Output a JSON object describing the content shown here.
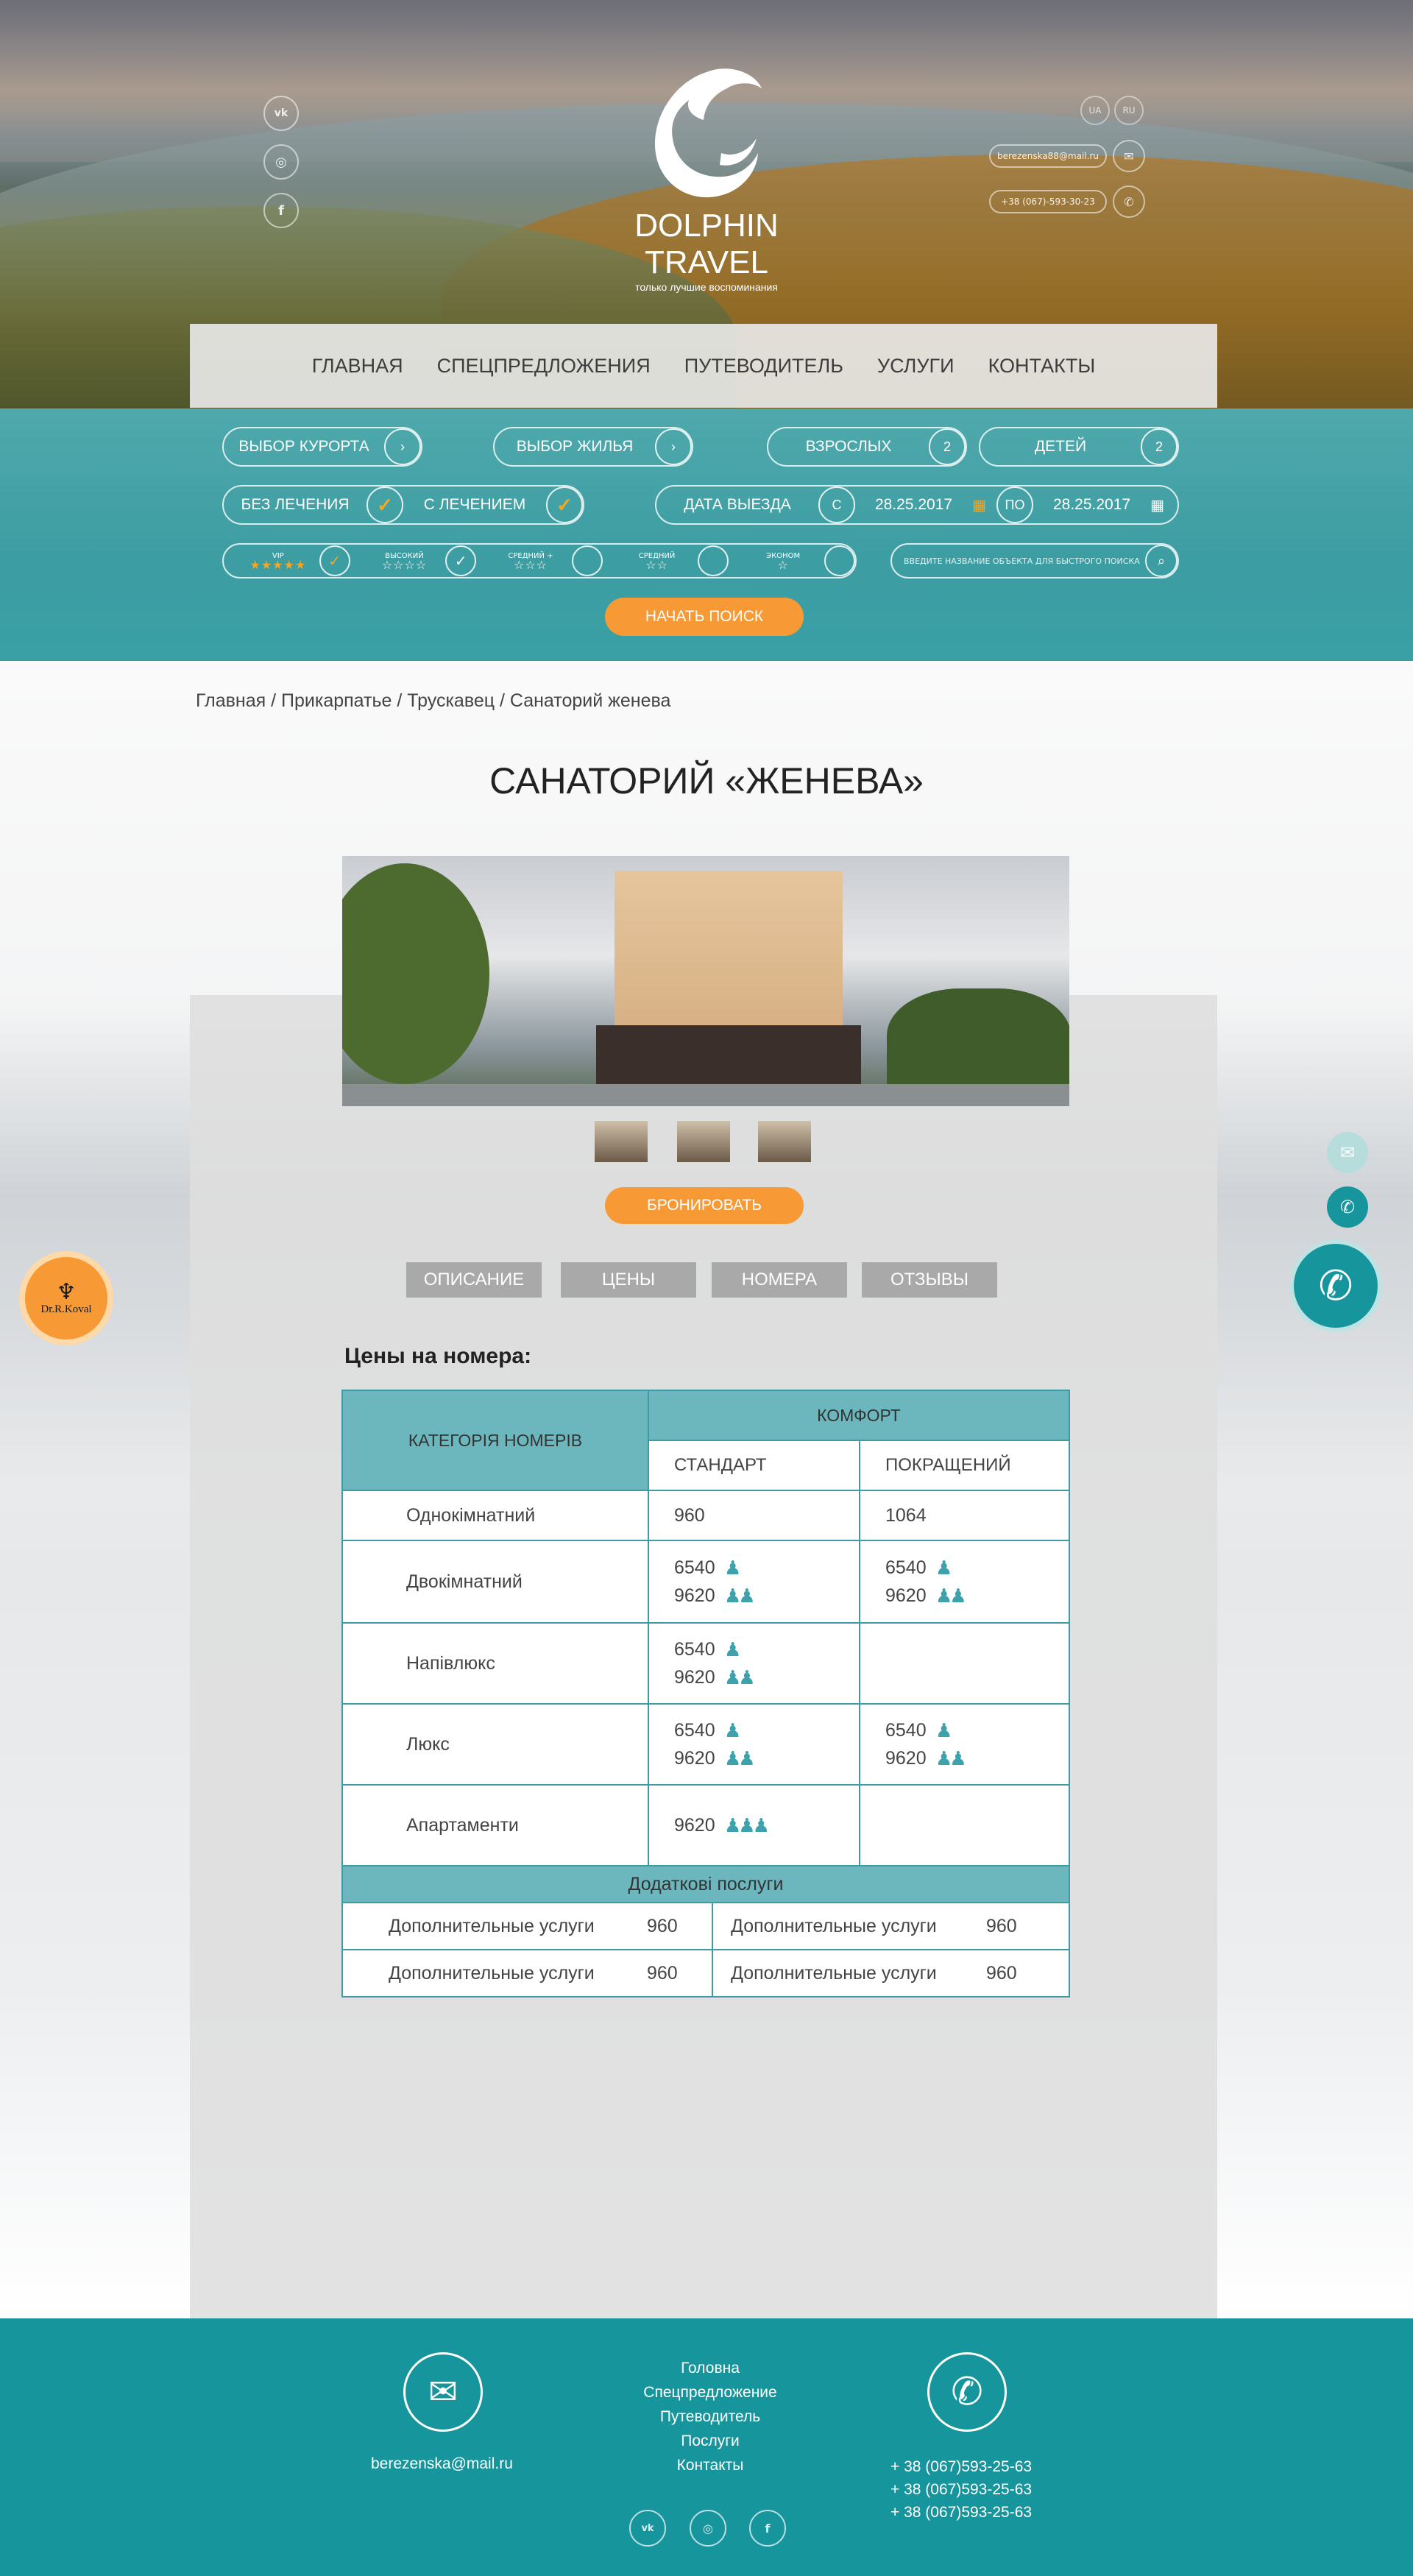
{
  "header": {
    "brand": "DOLPHIN TRAVEL",
    "tagline": "только лучшие воспоминания",
    "social": [
      {
        "icon": "vk-icon",
        "glyph": "vk"
      },
      {
        "icon": "instagram-icon",
        "glyph": "◎"
      },
      {
        "icon": "facebook-icon",
        "glyph": "f"
      }
    ],
    "languages": [
      "UA",
      "RU"
    ],
    "email": "berezenska88@mail.ru",
    "phone": "+38 (067)-593-30-23"
  },
  "nav": [
    "ГЛАВНАЯ",
    "СПЕЦПРЕДЛОЖЕНИЯ",
    "ПУТЕВОДИТЕЛЬ",
    "УСЛУГИ",
    "КОНТАКТЫ"
  ],
  "search": {
    "resort": "ВЫБОР КУРОРТА",
    "housing": "ВЫБОР ЖИЛЬЯ",
    "adults_label": "ВЗРОСЛЫХ",
    "adults_value": "2",
    "children_label": "ДЕТЕЙ",
    "children_value": "2",
    "no_treatment": "БЕЗ ЛЕЧЕНИЯ",
    "with_treatment": "С ЛЕЧЕНИЕМ",
    "departure_label": "ДАТА ВЫЕЗДА",
    "from_label": "С",
    "from_date": "28.25.2017",
    "to_label": "ПО",
    "to_date": "28.25.2017",
    "categories": [
      {
        "label": "VIP",
        "stars": "★★★★★"
      },
      {
        "label": "ВЫСОКИЙ",
        "stars": "☆☆☆☆"
      },
      {
        "label": "СРЕДНИЙ +",
        "stars": "☆☆☆"
      },
      {
        "label": "СРЕДНИЙ",
        "stars": "☆☆"
      },
      {
        "label": "ЭКОНОМ",
        "stars": "☆"
      }
    ],
    "quick_placeholder": "ВВЕДИТЕ НАЗВАНИЕ ОБЪЕКТА ДЛЯ БЫСТРОГО ПОИСКА",
    "submit": "НАЧАТЬ ПОИСК"
  },
  "breadcrumb": "Главная / Прикарпатье / Трускавец / Санаторий женева",
  "title": "САНАТОРИЙ «ЖЕНЕВА»",
  "book_button": "БРОНИРОВАТЬ",
  "tabs": [
    "ОПИСАНИЕ",
    "ЦЕНЫ",
    "НОМЕРА",
    "ОТЗЫВЫ"
  ],
  "prices": {
    "heading": "Цены на номера:",
    "category_header": "КАТЕГОРІЯ НОМЕРІВ",
    "group_header": "КОМФОРТ",
    "col1": "СТАНДАРТ",
    "col2": "ПОКРАЩЕНИЙ",
    "rows": [
      {
        "name": "Однокімнатний",
        "std": [
          {
            "v": "960",
            "p": ""
          }
        ],
        "imp": [
          {
            "v": "1064",
            "p": ""
          }
        ]
      },
      {
        "name": "Двокімнатний",
        "std": [
          {
            "v": "6540",
            "p": "1"
          },
          {
            "v": "9620",
            "p": "2"
          }
        ],
        "imp": [
          {
            "v": "6540",
            "p": "1"
          },
          {
            "v": "9620",
            "p": "2"
          }
        ]
      },
      {
        "name": "Напівлюкс",
        "std": [
          {
            "v": "6540",
            "p": "1"
          },
          {
            "v": "9620",
            "p": "2"
          }
        ],
        "imp": []
      },
      {
        "name": "Люкс",
        "std": [
          {
            "v": "6540",
            "p": "1"
          },
          {
            "v": "9620",
            "p": "2"
          }
        ],
        "imp": [
          {
            "v": "6540",
            "p": "1"
          },
          {
            "v": "9620",
            "p": "2"
          }
        ]
      },
      {
        "name": "Апартаменти",
        "std": [
          {
            "v": "9620",
            "p": "3"
          }
        ],
        "imp": []
      }
    ],
    "extra_header": "Додаткові послуги",
    "extras": [
      [
        {
          "label": "Дополнительные  услуги",
          "value": "960"
        },
        {
          "label": "Дополнительные  услуги",
          "value": "960"
        }
      ],
      [
        {
          "label": "Дополнительные  услуги",
          "value": "960"
        },
        {
          "label": "Дополнительные  услуги",
          "value": "960"
        }
      ]
    ]
  },
  "side_badge": "Dr.R.Koval",
  "footer": {
    "email": "berezenska@mail.ru",
    "nav": [
      "Головна",
      "Спецпредложение",
      "Путеводитель",
      "Послуги",
      "Контакты"
    ],
    "phones": [
      "+ 38 (067)593-25-63",
      "+ 38 (067)593-25-63",
      "+ 38 (067)593-25-63"
    ]
  },
  "colors": {
    "teal": "#17959d",
    "orange": "#f79a35",
    "table_head": "#6cb7bd"
  }
}
